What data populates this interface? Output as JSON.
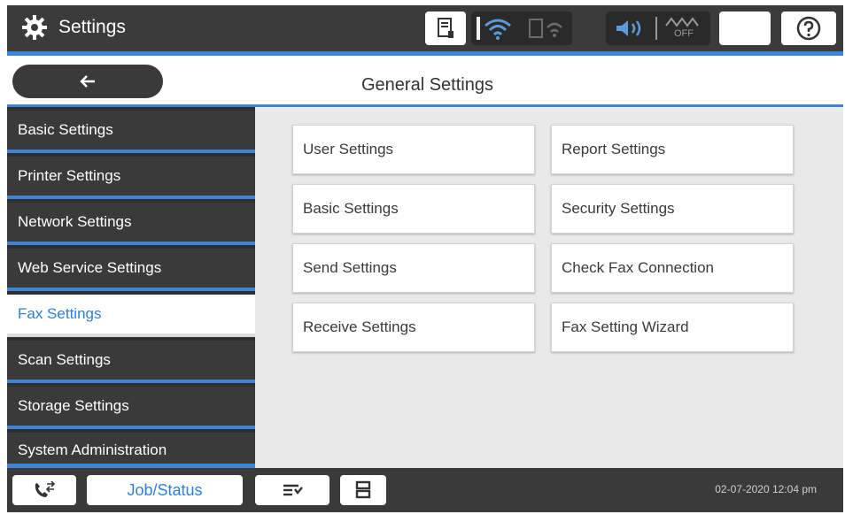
{
  "app": {
    "title": "Settings"
  },
  "header": {
    "title": "General Settings",
    "back_icon": "left-arrow-icon"
  },
  "status_icons": [
    "document-icon",
    "wifi-icon",
    "wifi-direct-icon",
    "sound-icon",
    "eco-off-icon",
    "sleep-moon-icon",
    "help-icon"
  ],
  "eco_label": "OFF",
  "sidebar": {
    "items": [
      {
        "label": "Basic Settings"
      },
      {
        "label": "Printer Settings"
      },
      {
        "label": "Network Settings"
      },
      {
        "label": "Web Service Settings"
      },
      {
        "label": "Fax Settings"
      },
      {
        "label": "Scan Settings"
      },
      {
        "label": "Storage Settings"
      },
      {
        "label": "System Administration"
      }
    ],
    "active": "Fax Settings"
  },
  "tiles": [
    {
      "label": "User Settings"
    },
    {
      "label": "Report Settings"
    },
    {
      "label": "Basic Settings"
    },
    {
      "label": "Security Settings"
    },
    {
      "label": "Send Settings"
    },
    {
      "label": "Check Fax Connection"
    },
    {
      "label": "Receive Settings"
    },
    {
      "label": "Fax Setting Wizard"
    }
  ],
  "bottombar": {
    "job_status": "Job/Status",
    "timestamp": "02-07-2020 12:04 pm"
  },
  "colors": {
    "accent": "#3d86d6",
    "active_text": "#2f7fd6",
    "bar": "#3a3a3a"
  }
}
